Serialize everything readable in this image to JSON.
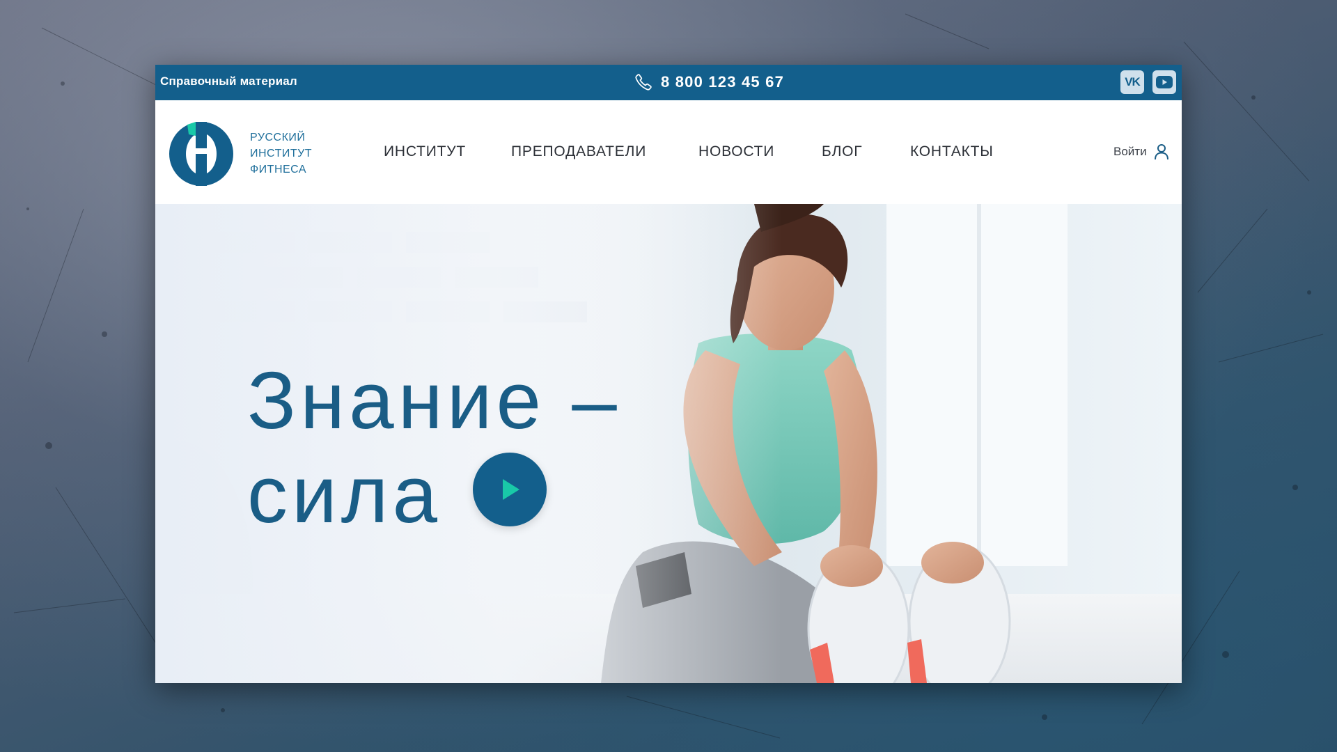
{
  "topbar": {
    "reference_label": "Справочный материал",
    "phone": "8 800 123 45 67",
    "phone_icon": "phone-icon",
    "socials": [
      {
        "name": "vk-icon",
        "label": "VK"
      },
      {
        "name": "youtube-icon"
      }
    ]
  },
  "header": {
    "logo": {
      "line1": "РУССКИЙ",
      "line2": "ИНСТИТУТ",
      "line3": "ФИТНЕСА"
    },
    "nav": [
      {
        "label": "ИНСТИТУТ"
      },
      {
        "label": "ПРЕПОДАВАТЕЛИ"
      },
      {
        "label": "НОВОСТИ"
      },
      {
        "label": "БЛОГ"
      },
      {
        "label": "КОНТАКТЫ"
      }
    ],
    "login_label": "Войти",
    "login_icon": "user-icon"
  },
  "hero": {
    "title_line1": "Знание –",
    "title_line2": "сила",
    "play_icon": "play-icon"
  },
  "colors": {
    "brand_blue": "#135f8c",
    "accent_teal": "#19c9a8",
    "text_blue": "#1a5d86"
  }
}
